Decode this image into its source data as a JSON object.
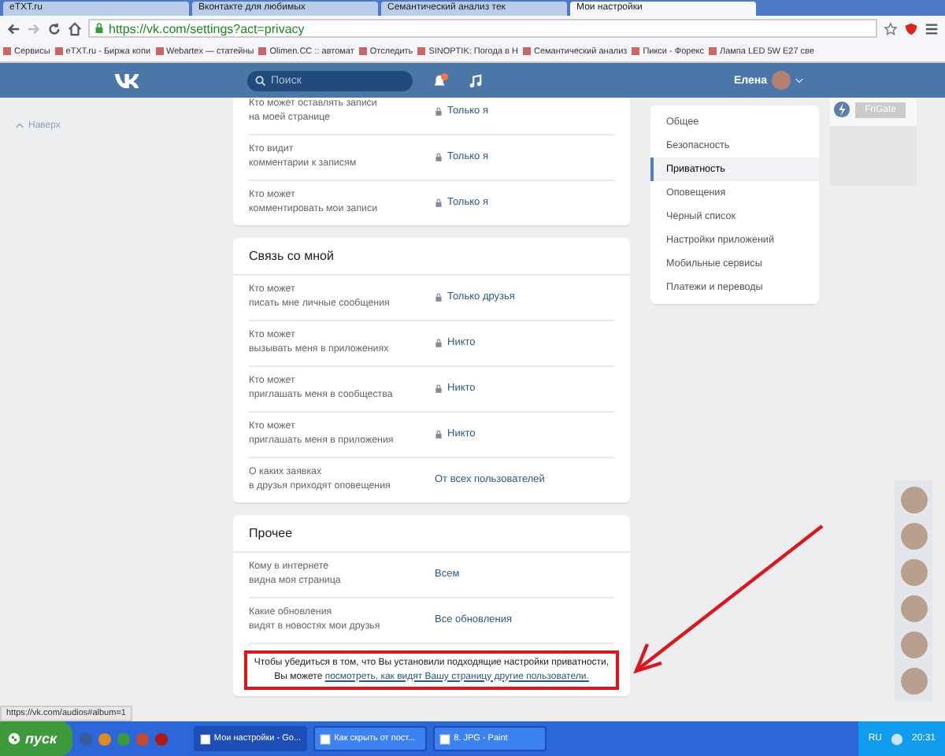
{
  "browser": {
    "tabs": [
      {
        "label": "eTXT.ru",
        "selected": false
      },
      {
        "label": "Вконтакте для любимых",
        "selected": false
      },
      {
        "label": "Семантический анализ тек",
        "selected": false
      },
      {
        "label": "Мои настройки",
        "selected": true
      }
    ],
    "address": "https://vk.com/settings?act=privacy",
    "bookmarks": [
      "Сервисы",
      "eTXT.ru - Биржа копи",
      "Webartex — статейны",
      "Olimen.CC :: автомат",
      "Отследить",
      "SINOPTIK: Погода в Н",
      "Семантический анализ",
      "Пикси - Форекс",
      "Лампа LED 5W E27 све"
    ]
  },
  "header": {
    "search": {
      "placeholder": "Поиск"
    },
    "user_name": "Елена"
  },
  "sidebar": {
    "back_to_top": "Наверх"
  },
  "sections": [
    {
      "rows": [
        {
          "label": "Кто может оставлять записи\nна моей странице",
          "value": "Только я",
          "locked": true
        },
        {
          "label": "Кто видит\nкомментарии к записям",
          "value": "Только я",
          "locked": true
        },
        {
          "label": "Кто может\nкомментировать мои записи",
          "value": "Только я",
          "locked": true
        }
      ]
    },
    {
      "title": "Связь со мной",
      "rows": [
        {
          "label": "Кто может\nписать мне личные сообщения",
          "value": "Только друзья",
          "locked": true
        },
        {
          "label": "Кто может\nвызывать меня в приложениях",
          "value": "Никто",
          "locked": true
        },
        {
          "label": "Кто может\nприглашать меня в сообщества",
          "value": "Никто",
          "locked": true
        },
        {
          "label": "Кто может\nприглашать меня в приложения",
          "value": "Никто",
          "locked": true
        },
        {
          "label": "О каких заявках\nв друзья приходят оповещения",
          "value": "От всех пользователей",
          "locked": false
        }
      ]
    },
    {
      "title": "Прочее",
      "rows": [
        {
          "label": "Кому в интернете\nвидна моя страница",
          "value": "Всем",
          "locked": false
        },
        {
          "label": "Какие обновления\nвидят в новостях мои друзья",
          "value": "Все обновления",
          "locked": false
        }
      ],
      "notice": {
        "text": "Чтобы убедиться в том, что Вы установили подходящие настройки приватности, Вы можете",
        "link": "посмотреть, как видят Вашу страницу другие пользователи."
      }
    }
  ],
  "settings_menu": [
    {
      "label": "Общее",
      "selected": false
    },
    {
      "label": "Безопасность",
      "selected": false
    },
    {
      "label": "Приватность",
      "selected": true
    },
    {
      "label": "Оповещения",
      "selected": false
    },
    {
      "label": "Чёрный список",
      "selected": false
    },
    {
      "label": "Настройки приложений",
      "selected": false
    },
    {
      "label": "Мобильные сервисы",
      "selected": false
    },
    {
      "label": "Платежи и переводы",
      "selected": false
    }
  ],
  "ad": {
    "button": "FriGate"
  },
  "status_url": "https://vk.com/audios#album=1",
  "taskbar": {
    "start": "пуск",
    "tasks": [
      {
        "label": "Мои настройки - Go...",
        "selected": true
      },
      {
        "label": "Как скрыть от пост...",
        "selected": false
      },
      {
        "label": "8. JPG - Paint",
        "selected": false
      }
    ],
    "language": "RU",
    "clock": "20:31"
  }
}
